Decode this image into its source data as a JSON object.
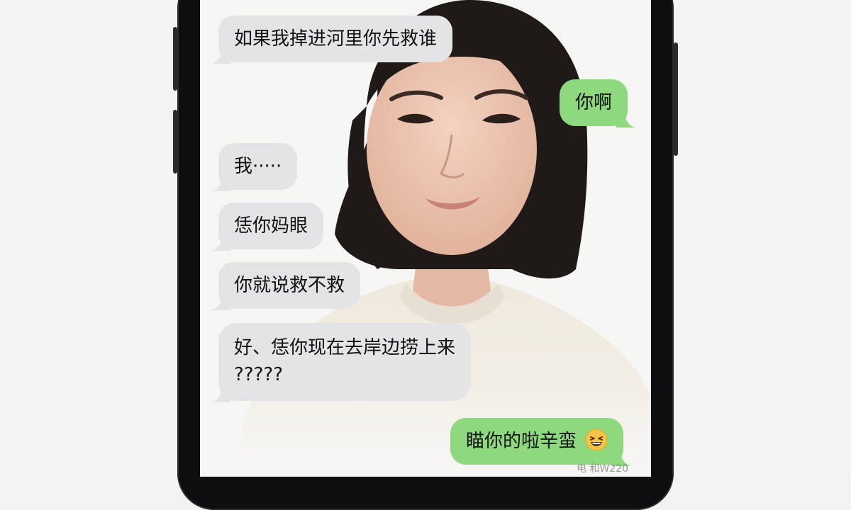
{
  "messages": [
    {
      "side": "in",
      "text": "如果我掉进河里你先救谁"
    },
    {
      "side": "out",
      "text": "你啊"
    },
    {
      "side": "in",
      "text": "我·····"
    },
    {
      "side": "in",
      "text": "恁你妈眼"
    },
    {
      "side": "in",
      "text": "你就说救不救"
    },
    {
      "side": "in",
      "text": "好、恁你现在去岸边捞上来",
      "text2": "?????"
    },
    {
      "side": "out",
      "text": "瞄你的啦辛蛮",
      "emoji": "grinning-squinting-face"
    }
  ],
  "watermark": "电 和W220",
  "colors": {
    "incoming_bubble": "#e4e4e6",
    "outgoing_bubble": "#8ed87d",
    "phone_frame": "#0e0e10"
  }
}
